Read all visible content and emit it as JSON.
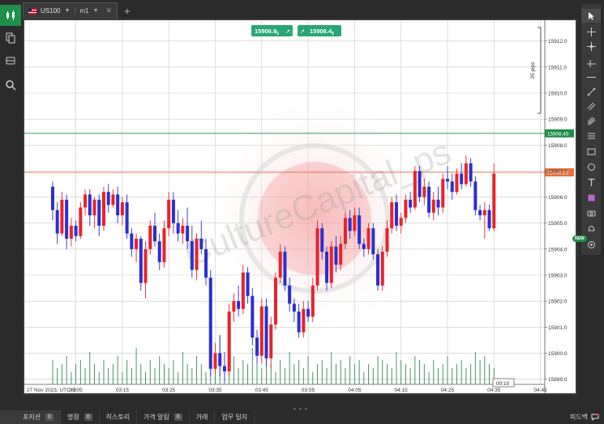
{
  "tabs": [
    {
      "symbol": "US100",
      "timeframe": "m1"
    }
  ],
  "chart_data": {
    "type": "candlestick",
    "symbol": "US100",
    "price_ticks": [
      "15912.0",
      "15911.0",
      "15910.0",
      "15909.0",
      "15908.0",
      "15907.0",
      "15906.0",
      "15905.0",
      "15904.0",
      "15903.0",
      "15902.0",
      "15901.0",
      "15900.0",
      "15899.0"
    ],
    "price_tick_values": [
      15912,
      15911,
      15910,
      15909,
      15908,
      15907,
      15906,
      15905,
      15904,
      15903,
      15902,
      15901,
      15900,
      15899
    ],
    "y_range": [
      15898.8,
      15912.8
    ],
    "time_ticks": [
      "27 Nov 2023, UTC+0",
      "03:05",
      "03:15",
      "03:25",
      "03:35",
      "03:45",
      "03:55",
      "04:05",
      "04:15",
      "04:25",
      "04:35",
      "04:45"
    ],
    "time_tick_minutes": [
      null,
      5,
      15,
      25,
      35,
      45,
      55,
      65,
      75,
      85,
      95,
      105
    ],
    "minute_range": [
      -5.4,
      105.6
    ],
    "levels": [
      {
        "price": 15908.45,
        "label": "15908.45",
        "color": "#1f8f4a"
      },
      {
        "price": 15906.95,
        "label": "15906.95",
        "color": "#e8703a"
      }
    ],
    "sell_label": "15906.9",
    "sell_superscript": "5",
    "buy_label": "15908.4",
    "buy_superscript": "5",
    "countdown": "00:10",
    "measure_label": "25 pips",
    "watermark": "CultureCapital_ps",
    "candles": [
      [
        15906.4,
        15906.6,
        15905.1,
        15905.5
      ],
      [
        15905.5,
        15905.8,
        15904.2,
        15904.6
      ],
      [
        15904.6,
        15906.2,
        15904.5,
        15905.9
      ],
      [
        15905.9,
        15906.1,
        15904.0,
        15904.4
      ],
      [
        15904.4,
        15905.2,
        15904.1,
        15904.9
      ],
      [
        15904.9,
        15905.1,
        15904.3,
        15904.5
      ],
      [
        15904.5,
        15905.8,
        15904.4,
        15905.6
      ],
      [
        15905.6,
        15906.3,
        15905.3,
        15906.1
      ],
      [
        15906.1,
        15906.3,
        15904.9,
        15905.3
      ],
      [
        15905.3,
        15906.0,
        15904.8,
        15905.9
      ],
      [
        15905.9,
        15906.1,
        15904.5,
        15904.9
      ],
      [
        15904.9,
        15906.4,
        15904.7,
        15906.2
      ],
      [
        15906.2,
        15906.5,
        15905.4,
        15905.7
      ],
      [
        15905.7,
        15906.3,
        15905.6,
        15906.1
      ],
      [
        15906.1,
        15906.4,
        15905.0,
        15905.3
      ],
      [
        15905.3,
        15906.0,
        15904.9,
        15905.8
      ],
      [
        15905.8,
        15906.1,
        15904.4,
        15904.6
      ],
      [
        15904.6,
        15904.8,
        15903.7,
        15904.0
      ],
      [
        15904.0,
        15904.6,
        15903.5,
        15904.4
      ],
      [
        15904.4,
        15904.5,
        15902.4,
        15902.7
      ],
      [
        15902.7,
        15904.3,
        15902.1,
        15904.0
      ],
      [
        15904.0,
        15905.1,
        15903.8,
        15904.9
      ],
      [
        15904.9,
        15905.4,
        15904.1,
        15904.3
      ],
      [
        15904.3,
        15904.6,
        15903.2,
        15903.5
      ],
      [
        15903.5,
        15905.1,
        15903.3,
        15904.8
      ],
      [
        15904.8,
        15906.2,
        15904.5,
        15905.9
      ],
      [
        15905.9,
        15906.2,
        15904.6,
        15905.0
      ],
      [
        15905.0,
        15905.5,
        15904.3,
        15904.6
      ],
      [
        15904.6,
        15905.2,
        15904.2,
        15904.9
      ],
      [
        15904.9,
        15905.6,
        15904.0,
        15904.3
      ],
      [
        15904.3,
        15904.9,
        15902.9,
        15903.2
      ],
      [
        15903.2,
        15904.6,
        15902.8,
        15904.4
      ],
      [
        15904.4,
        15905.1,
        15903.8,
        15904.0
      ],
      [
        15904.0,
        15904.4,
        15902.6,
        15902.9
      ],
      [
        15902.9,
        15903.2,
        15899.1,
        15899.4
      ],
      [
        15899.4,
        15900.4,
        15899.2,
        15900.0
      ],
      [
        15900.0,
        15900.7,
        15899.1,
        15899.5
      ],
      [
        15899.5,
        15900.0,
        15898.9,
        15899.3
      ],
      [
        15899.3,
        15901.9,
        15899.1,
        15901.6
      ],
      [
        15901.6,
        15902.3,
        15901.2,
        15902.0
      ],
      [
        15902.0,
        15902.6,
        15901.4,
        15901.7
      ],
      [
        15901.7,
        15903.4,
        15901.5,
        15903.1
      ],
      [
        15903.1,
        15903.3,
        15901.9,
        15902.2
      ],
      [
        15902.2,
        15902.5,
        15900.3,
        15900.6
      ],
      [
        15900.6,
        15900.9,
        15899.6,
        15899.9
      ],
      [
        15899.9,
        15902.1,
        15899.6,
        15901.8
      ],
      [
        15901.8,
        15902.1,
        15899.5,
        15899.8
      ],
      [
        15899.8,
        15901.4,
        15899.4,
        15901.1
      ],
      [
        15901.1,
        15903.1,
        15900.9,
        15902.9
      ],
      [
        15902.9,
        15904.2,
        15902.7,
        15903.9
      ],
      [
        15903.9,
        15904.1,
        15902.4,
        15902.6
      ],
      [
        15902.6,
        15902.9,
        15901.6,
        15901.9
      ],
      [
        15901.9,
        15902.1,
        15901.2,
        15901.6
      ],
      [
        15901.6,
        15901.9,
        15900.6,
        15900.8
      ],
      [
        15900.8,
        15902.0,
        15900.6,
        15901.7
      ],
      [
        15901.7,
        15902.0,
        15901.2,
        15901.4
      ],
      [
        15901.4,
        15902.9,
        15901.2,
        15902.6
      ],
      [
        15902.6,
        15905.1,
        15902.4,
        15904.8
      ],
      [
        15904.8,
        15905.0,
        15903.6,
        15903.9
      ],
      [
        15903.9,
        15904.1,
        15902.4,
        15902.7
      ],
      [
        15902.7,
        15904.3,
        15902.5,
        15904.1
      ],
      [
        15904.1,
        15904.5,
        15903.1,
        15903.4
      ],
      [
        15903.4,
        15904.5,
        15903.2,
        15904.2
      ],
      [
        15904.2,
        15905.4,
        15904.0,
        15905.2
      ],
      [
        15905.2,
        15905.5,
        15904.4,
        15904.7
      ],
      [
        15904.7,
        15905.6,
        15904.5,
        15905.3
      ],
      [
        15905.3,
        15905.6,
        15904.0,
        15904.2
      ],
      [
        15904.2,
        15904.4,
        15903.7,
        15904.0
      ],
      [
        15904.0,
        15905.0,
        15903.8,
        15904.8
      ],
      [
        15904.8,
        15905.0,
        15903.6,
        15903.8
      ],
      [
        15903.8,
        15904.0,
        15902.4,
        15902.6
      ],
      [
        15902.6,
        15904.1,
        15902.4,
        15903.9
      ],
      [
        15903.9,
        15905.1,
        15903.7,
        15904.8
      ],
      [
        15904.8,
        15906.0,
        15904.6,
        15905.8
      ],
      [
        15905.8,
        15906.1,
        15904.7,
        15904.9
      ],
      [
        15904.9,
        15905.4,
        15904.6,
        15905.2
      ],
      [
        15905.2,
        15906.1,
        15905.0,
        15905.9
      ],
      [
        15905.9,
        15906.2,
        15905.4,
        15905.6
      ],
      [
        15905.6,
        15907.2,
        15905.5,
        15907.0
      ],
      [
        15907.0,
        15907.2,
        15905.8,
        15906.0
      ],
      [
        15906.0,
        15906.7,
        15905.7,
        15906.4
      ],
      [
        15906.4,
        15906.6,
        15905.2,
        15905.4
      ],
      [
        15905.4,
        15906.2,
        15905.1,
        15905.9
      ],
      [
        15905.9,
        15906.4,
        15905.3,
        15905.6
      ],
      [
        15905.6,
        15906.9,
        15905.4,
        15906.7
      ],
      [
        15906.7,
        15907.2,
        15906.3,
        15906.6
      ],
      [
        15906.6,
        15906.9,
        15905.9,
        15906.2
      ],
      [
        15906.2,
        15907.1,
        15906.1,
        15906.9
      ],
      [
        15906.9,
        15907.3,
        15906.3,
        15906.5
      ],
      [
        15906.5,
        15907.6,
        15906.4,
        15907.3
      ],
      [
        15907.3,
        15907.5,
        15906.4,
        15906.6
      ],
      [
        15906.6,
        15906.8,
        15905.3,
        15905.5
      ],
      [
        15905.5,
        15905.7,
        15905.1,
        15905.3
      ],
      [
        15905.3,
        15905.8,
        15904.4,
        15905.5
      ],
      [
        15905.5,
        15905.7,
        15904.7,
        15904.8
      ],
      [
        15904.8,
        15907.3,
        15904.7,
        15906.9
      ]
    ],
    "volumes": [
      6,
      4,
      5,
      7,
      3,
      5,
      6,
      4,
      8,
      5,
      3,
      6,
      4,
      5,
      7,
      3,
      6,
      4,
      9,
      5,
      3,
      6,
      4,
      7,
      5,
      4,
      6,
      3,
      8,
      5,
      4,
      7,
      5,
      3,
      6,
      4,
      12,
      8,
      5,
      7,
      4,
      6,
      5,
      9,
      6,
      4,
      7,
      5,
      3,
      6,
      4,
      8,
      5,
      6,
      4,
      7,
      3,
      5,
      6,
      4,
      8,
      5,
      6,
      4,
      7,
      5,
      6,
      3,
      5,
      4,
      7,
      6,
      5,
      4,
      8,
      6,
      5,
      4,
      7,
      6,
      5,
      3,
      6,
      4,
      5,
      7,
      4,
      5,
      6,
      4,
      5,
      8,
      6,
      7,
      5,
      4
    ]
  },
  "toolbar": {
    "new_badge": "NEW"
  },
  "bottom": {
    "items": [
      {
        "label": "포지션",
        "count": "0"
      },
      {
        "label": "명령",
        "count": "0"
      },
      {
        "label": "히스토리"
      },
      {
        "label": "가격 알림",
        "count": "0"
      },
      {
        "label": "거래"
      },
      {
        "label": "업무 일지"
      }
    ],
    "feedback": "피드백"
  }
}
